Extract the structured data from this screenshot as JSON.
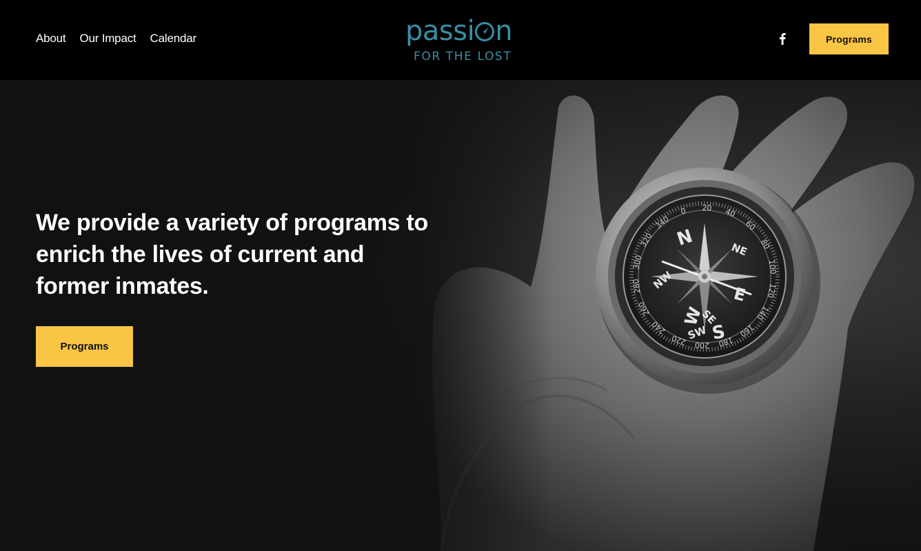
{
  "nav": {
    "items": [
      {
        "label": "About"
      },
      {
        "label": "Our Impact"
      },
      {
        "label": "Calendar"
      }
    ]
  },
  "logo": {
    "word_before": "passi",
    "word_after": "n",
    "subtitle": "FOR THE LOST",
    "color": "#3a8ea3",
    "icon": "compass-needle-icon"
  },
  "social": {
    "icon": "facebook-icon"
  },
  "header_cta": {
    "label": "Programs"
  },
  "hero": {
    "title": "We provide a variety of programs  to\nenrich the lives of current and\nformer inmates.",
    "cta_label": "Programs",
    "image": "hand-holding-compass-photo",
    "compass_letters": [
      "N",
      "NE",
      "E",
      "SE",
      "S",
      "SW",
      "W",
      "NW"
    ],
    "compass_degrees": [
      "0",
      "20",
      "40",
      "60",
      "80",
      "100",
      "120",
      "140",
      "160",
      "180",
      "200",
      "220",
      "240",
      "260",
      "280",
      "300",
      "320",
      "340"
    ]
  },
  "colors": {
    "accent": "#f8c545",
    "header_bg": "#000000",
    "brand": "#3a8ea3"
  }
}
